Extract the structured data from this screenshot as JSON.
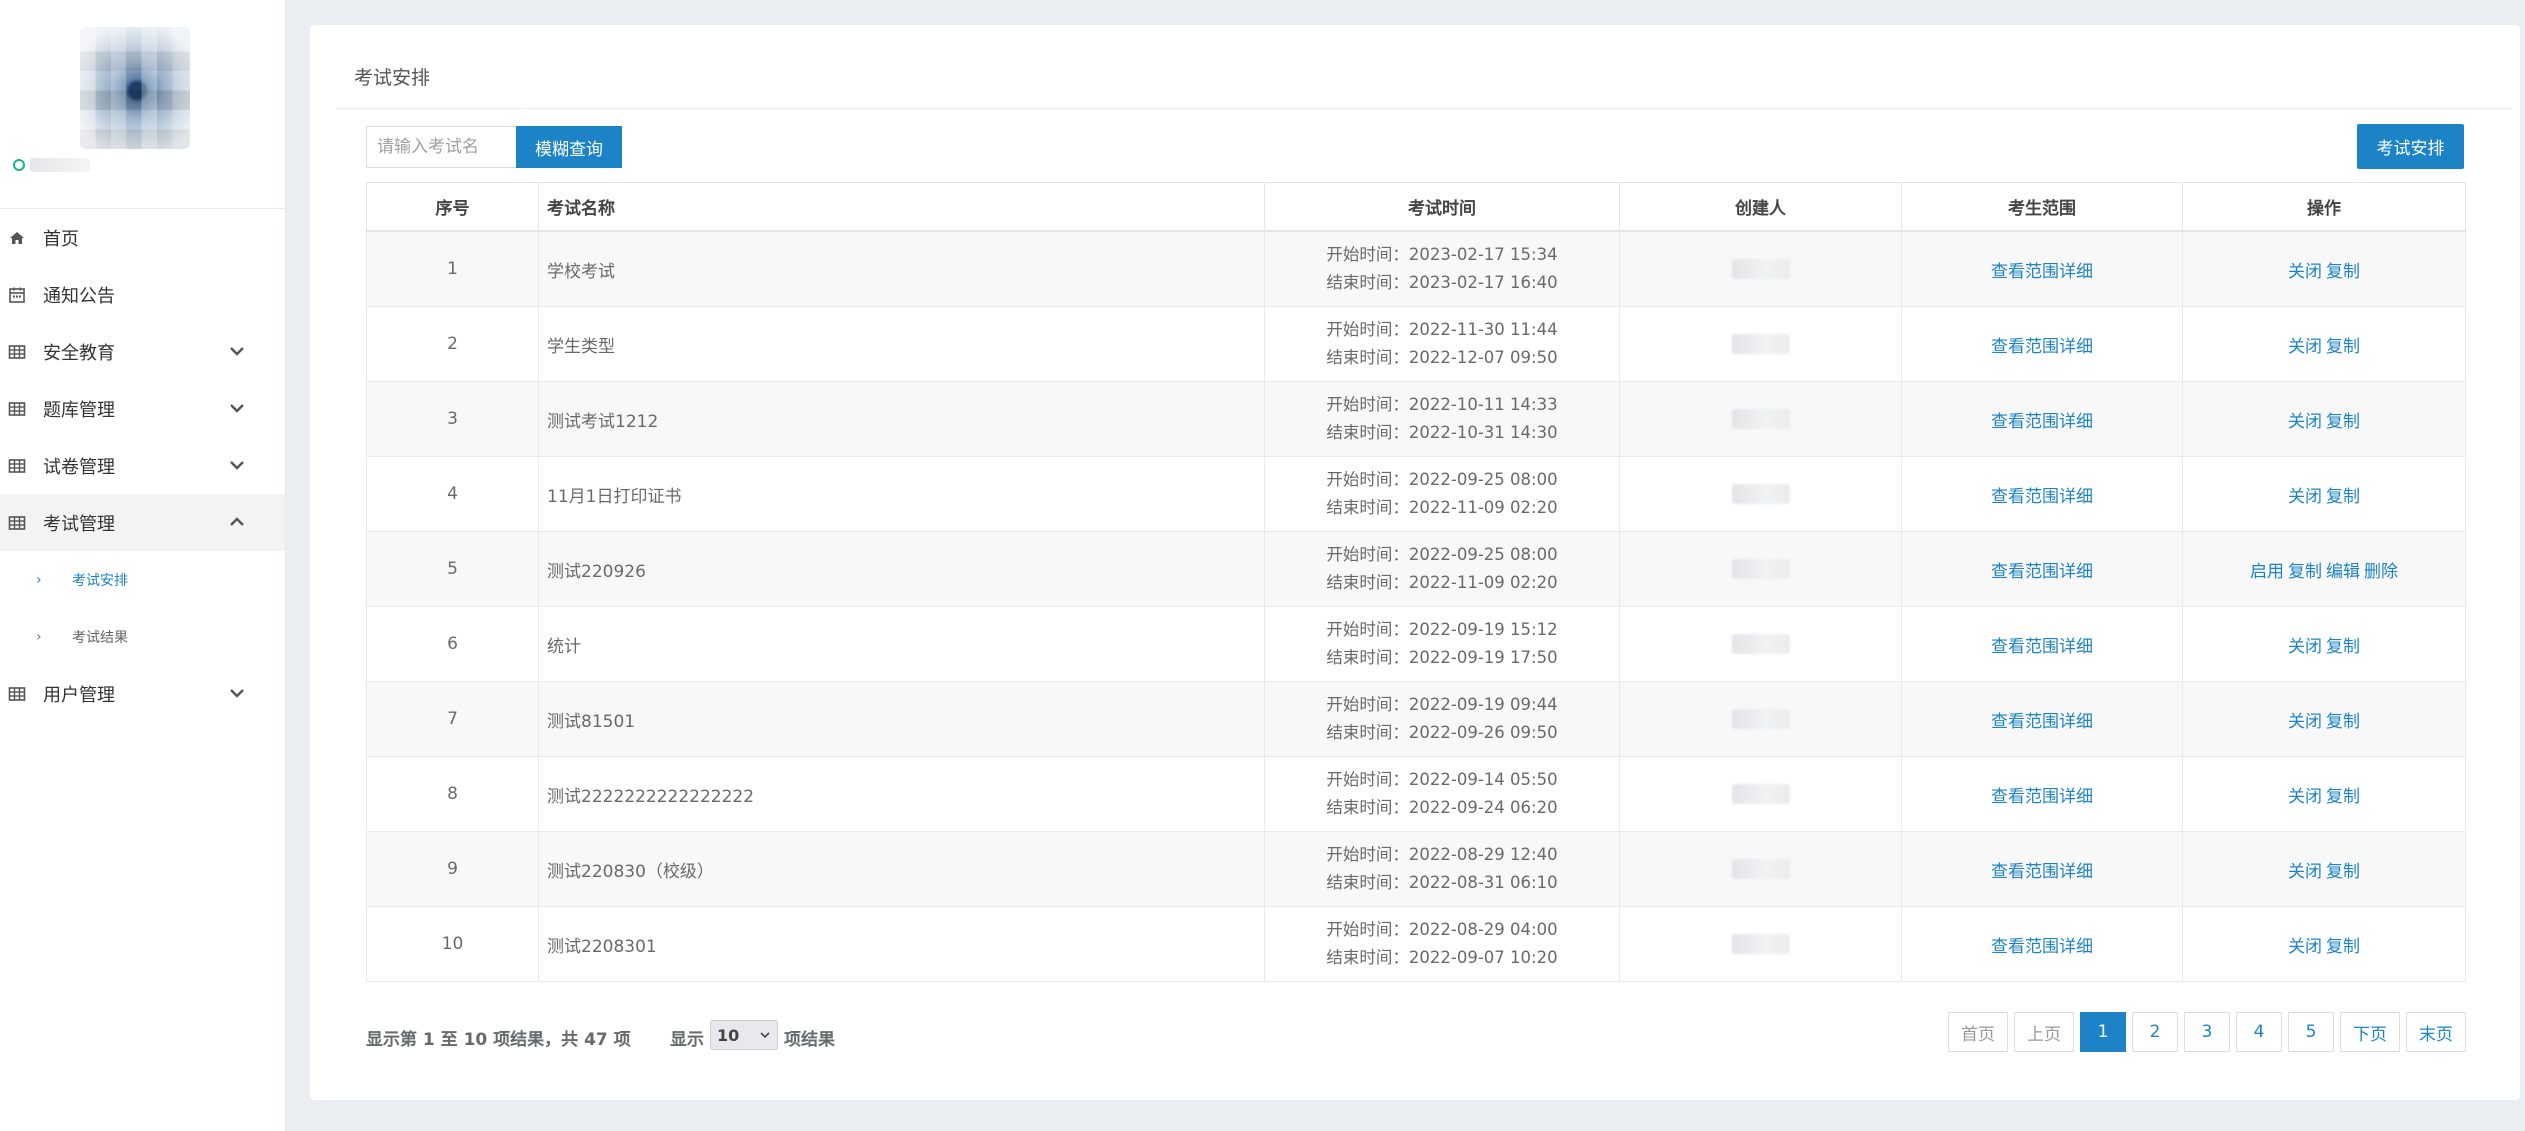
{
  "sidebar": {
    "nav": [
      {
        "label": "首页",
        "icon": "home-icon"
      },
      {
        "label": "通知公告",
        "icon": "calendar-icon"
      },
      {
        "label": "安全教育",
        "icon": "table-icon"
      },
      {
        "label": "题库管理",
        "icon": "table-icon"
      },
      {
        "label": "试卷管理",
        "icon": "table-icon"
      },
      {
        "label": "考试管理",
        "icon": "table-icon"
      },
      {
        "label": "用户管理",
        "icon": "table-icon"
      }
    ],
    "exam_sub": [
      {
        "label": "考试安排"
      },
      {
        "label": "考试结果"
      }
    ]
  },
  "page": {
    "title": "考试安排",
    "search_placeholder": "请输入考试名",
    "search_button": "模糊查询",
    "arrange_button": "考试安排"
  },
  "table": {
    "headers": [
      "序号",
      "考试名称",
      "考试时间",
      "创建人",
      "考生范围",
      "操作"
    ],
    "scope_link": "查看范围详细",
    "rows": [
      {
        "no": "1",
        "name": "学校考试",
        "start": "开始时间：2023-02-17 15:34",
        "end": "结束时间：2023-02-17 16:40",
        "ops": [
          "关闭",
          "复制"
        ]
      },
      {
        "no": "2",
        "name": "学生类型",
        "start": "开始时间：2022-11-30 11:44",
        "end": "结束时间：2022-12-07 09:50",
        "ops": [
          "关闭",
          "复制"
        ]
      },
      {
        "no": "3",
        "name": "测试考试1212",
        "start": "开始时间：2022-10-11 14:33",
        "end": "结束时间：2022-10-31 14:30",
        "ops": [
          "关闭",
          "复制"
        ]
      },
      {
        "no": "4",
        "name": "11月1日打印证书",
        "start": "开始时间：2022-09-25 08:00",
        "end": "结束时间：2022-11-09 02:20",
        "ops": [
          "关闭",
          "复制"
        ]
      },
      {
        "no": "5",
        "name": "测试220926",
        "start": "开始时间：2022-09-25 08:00",
        "end": "结束时间：2022-11-09 02:20",
        "ops": [
          "启用",
          "复制",
          "编辑",
          "删除"
        ]
      },
      {
        "no": "6",
        "name": "统计",
        "start": "开始时间：2022-09-19 15:12",
        "end": "结束时间：2022-09-19 17:50",
        "ops": [
          "关闭",
          "复制"
        ]
      },
      {
        "no": "7",
        "name": "测试81501",
        "start": "开始时间：2022-09-19 09:44",
        "end": "结束时间：2022-09-26 09:50",
        "ops": [
          "关闭",
          "复制"
        ]
      },
      {
        "no": "8",
        "name": "测试2222222222222222",
        "start": "开始时间：2022-09-14 05:50",
        "end": "结束时间：2022-09-24 06:20",
        "ops": [
          "关闭",
          "复制"
        ]
      },
      {
        "no": "9",
        "name": "测试220830（校级）",
        "start": "开始时间：2022-08-29 12:40",
        "end": "结束时间：2022-08-31 06:10",
        "ops": [
          "关闭",
          "复制"
        ]
      },
      {
        "no": "10",
        "name": "测试2208301",
        "start": "开始时间：2022-08-29 04:00",
        "end": "结束时间：2022-09-07 10:20",
        "ops": [
          "关闭",
          "复制"
        ]
      }
    ]
  },
  "footer": {
    "summary": "显示第 1 至 10 项结果，共 47 项",
    "pagesize_label": "显示",
    "pagesize_value": "10",
    "pagesize_suffix": "项结果",
    "pager": [
      "首页",
      "上页",
      "1",
      "2",
      "3",
      "4",
      "5",
      "下页",
      "末页"
    ],
    "current_page": "1"
  },
  "colors": {
    "accent": "#1c84c6",
    "online": "#1ab394"
  }
}
